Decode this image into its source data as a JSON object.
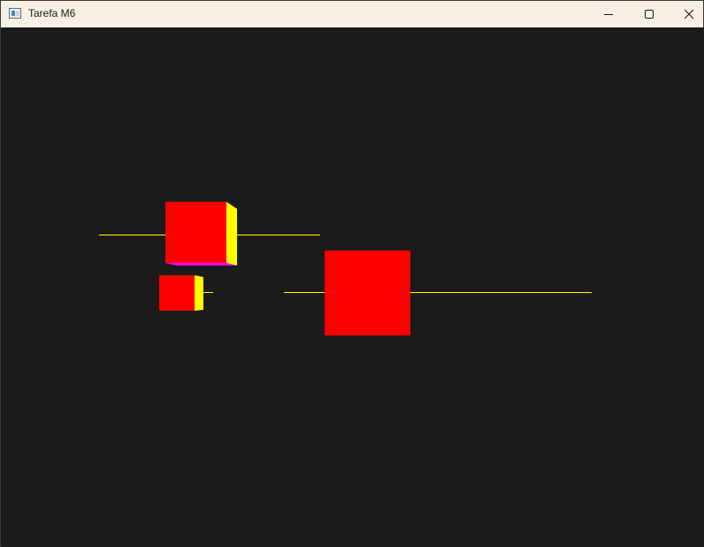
{
  "window": {
    "title": "Tarefa M6",
    "icons": {
      "app": "app-window-icon",
      "minimize": "minimize-icon",
      "maximize": "maximize-icon",
      "close": "close-icon"
    }
  },
  "scene": {
    "background": "#1b1b1b",
    "colors": {
      "cube_front": "#ff0000",
      "cube_side": "#ffff00",
      "cube_bottom": "#ff00ff",
      "axis_line": "#ffff00"
    }
  }
}
